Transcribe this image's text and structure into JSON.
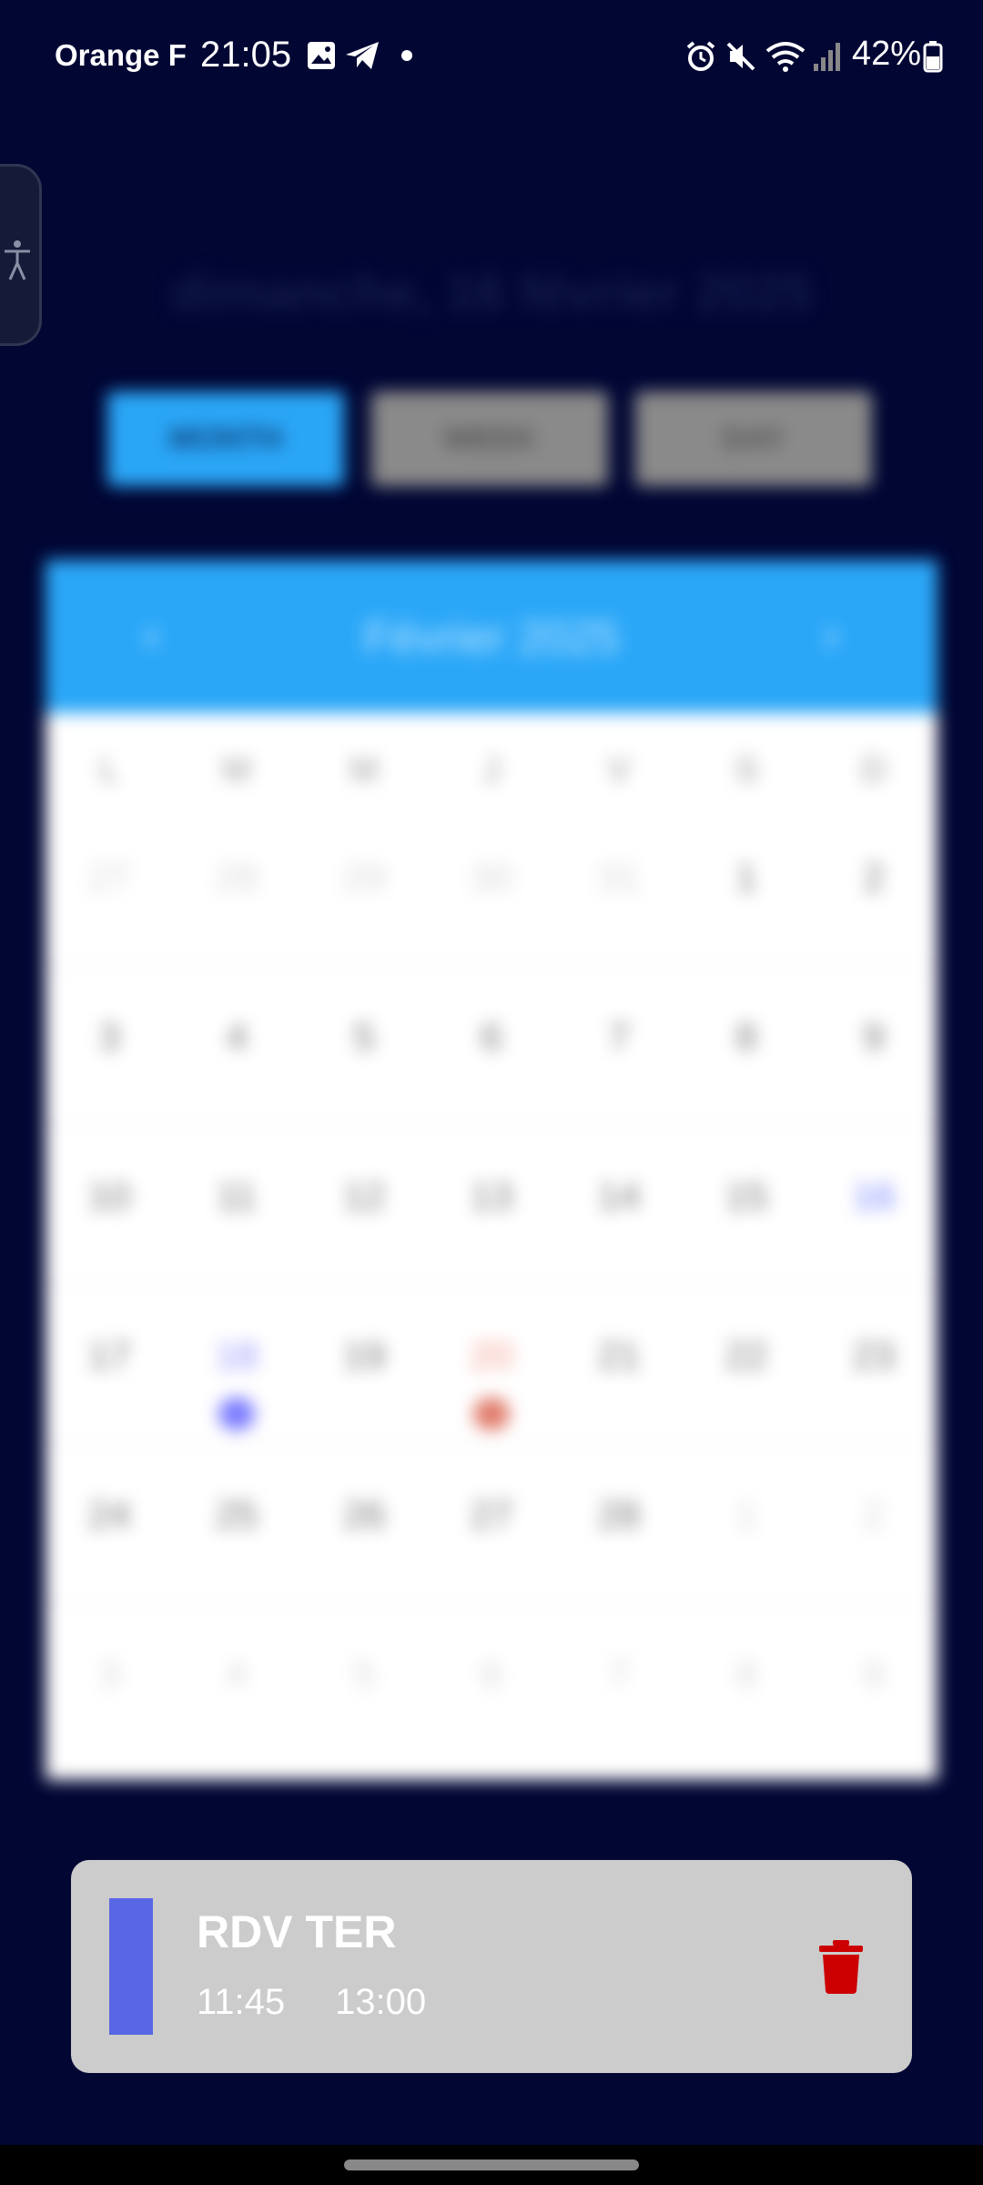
{
  "status_bar": {
    "carrier": "Orange F",
    "time": "21:05",
    "battery": "42%",
    "icons": [
      "gallery-icon",
      "telegram-icon",
      "dot-icon",
      "alarm-icon",
      "mute-icon",
      "wifi-icon",
      "signal-icon",
      "battery-icon"
    ]
  },
  "accessibility": {
    "icon": "accessibility-icon"
  },
  "header": {
    "date": "dimanche, 16 février 2025"
  },
  "view_buttons": {
    "month": "MONTH",
    "week": "WEEK",
    "day": "DAY"
  },
  "calendar": {
    "title": "Février  2025",
    "prev": "‹",
    "next": "›",
    "weekdays": [
      "L",
      "M",
      "M",
      "J",
      "V",
      "S",
      "D"
    ],
    "weeks": [
      [
        "27",
        "28",
        "29",
        "30",
        "31",
        "1",
        "2"
      ],
      [
        "3",
        "4",
        "5",
        "6",
        "7",
        "8",
        "9"
      ],
      [
        "10",
        "11",
        "12",
        "13",
        "14",
        "15",
        "16"
      ],
      [
        "17",
        "18",
        "19",
        "20",
        "21",
        "22",
        "23"
      ],
      [
        "24",
        "25",
        "26",
        "27",
        "28",
        "1",
        "2"
      ],
      [
        "3",
        "4",
        "5",
        "6",
        "7",
        "8",
        "9"
      ]
    ]
  },
  "event": {
    "title": "RDV TER",
    "start": "11:45",
    "end": "13:00",
    "color": "#5966e6",
    "delete_icon": "trash-icon"
  },
  "colors": {
    "background": "#010633",
    "accent": "#2aa6f7",
    "delete": "#cc0000"
  }
}
